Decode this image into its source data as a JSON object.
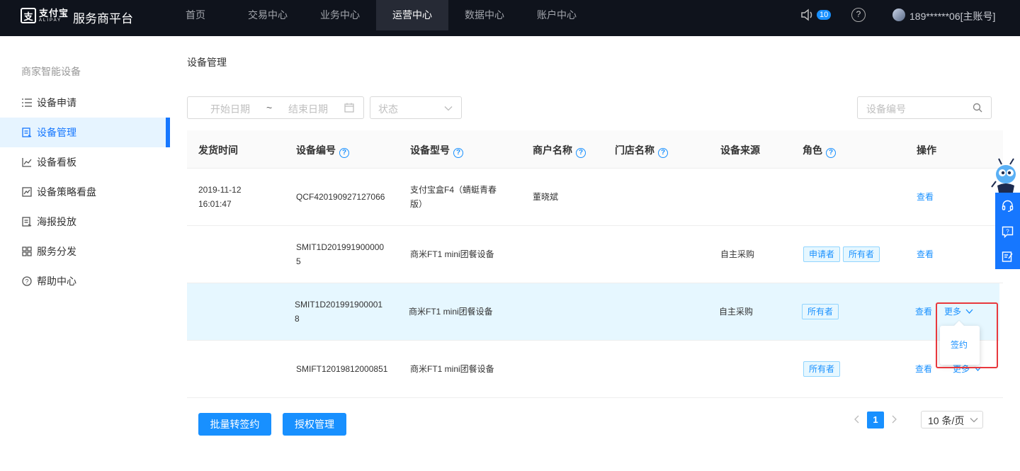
{
  "header": {
    "logo": {
      "mark": "支",
      "cn": "支付宝",
      "en": "ALIPAY"
    },
    "platform_name": "服务商平台",
    "nav": [
      "首页",
      "交易中心",
      "业务中心",
      "运营中心",
      "数据中心",
      "账户中心"
    ],
    "active_nav": "运营中心",
    "notification_count": "10",
    "help_symbol": "?",
    "account": "189******06[主账号]"
  },
  "sidebar": {
    "group_title": "商家智能设备",
    "items": [
      {
        "label": "设备申请",
        "icon": "list-icon"
      },
      {
        "label": "设备管理",
        "icon": "device-manage-icon",
        "active": true
      },
      {
        "label": "设备看板",
        "icon": "line-chart-icon"
      },
      {
        "label": "设备策略看盘",
        "icon": "area-chart-icon"
      },
      {
        "label": "海报投放",
        "icon": "poster-icon"
      },
      {
        "label": "服务分发",
        "icon": "grid-icon"
      },
      {
        "label": "帮助中心",
        "icon": "question-circle-icon"
      }
    ]
  },
  "main": {
    "title": "设备管理",
    "filters": {
      "start_date_placeholder": "开始日期",
      "range_separator": "~",
      "end_date_placeholder": "结束日期",
      "status_placeholder": "状态",
      "device_no_placeholder": "设备编号"
    },
    "table": {
      "help_symbol": "?",
      "columns": {
        "ship_time": "发货时间",
        "device_no": "设备编号",
        "device_model": "设备型号",
        "merchant": "商户名称",
        "store": "门店名称",
        "source": "设备来源",
        "role": "角色",
        "action": "操作"
      },
      "rows": [
        {
          "ship_date": "2019-11-12",
          "ship_clock": "16:01:47",
          "device_no_1": "QCF420190927127066",
          "device_no_2": "",
          "model_1": "支付宝盒F4（蜻蜓青春",
          "model_2": "版）",
          "merchant": "董晓斌",
          "store": "",
          "source": "",
          "roles": [],
          "view": "查看",
          "more": ""
        },
        {
          "ship_date": "",
          "ship_clock": "",
          "device_no_1": "SMIT1D201991900000",
          "device_no_2": "5",
          "model_1": "商米FT1 mini团餐设备",
          "model_2": "",
          "merchant": "",
          "store": "",
          "source": "自主采购",
          "roles": [
            "申请者",
            "所有者"
          ],
          "view": "查看",
          "more": ""
        },
        {
          "ship_date": "",
          "ship_clock": "",
          "device_no_1": "SMIT1D201991900001",
          "device_no_2": "8",
          "model_1": "商米FT1 mini团餐设备",
          "model_2": "",
          "merchant": "",
          "store": "",
          "source": "自主采购",
          "roles": [
            "所有者"
          ],
          "view": "查看",
          "more": "更多"
        },
        {
          "ship_date": "",
          "ship_clock": "",
          "device_no_1": "SMIFT12019812000851",
          "device_no_2": "",
          "model_1": "商米FT1 mini团餐设备",
          "model_2": "",
          "merchant": "",
          "store": "",
          "source": "",
          "roles": [
            "所有者"
          ],
          "view": "查看",
          "more": "更多"
        }
      ]
    },
    "more_menu": {
      "items": [
        "签约"
      ]
    },
    "footer": {
      "batch_button": "批量转签约",
      "auth_button": "授权管理",
      "current_page": "1",
      "page_size": "10 条/页"
    }
  },
  "float_panel": {
    "icons": [
      "headset-icon",
      "feedback-icon",
      "edit-note-icon"
    ]
  },
  "colors": {
    "primary": "#1890ff",
    "topbar": "#0f131c",
    "highlight_row": "#e6f7ff",
    "annotation": "#e8383d"
  }
}
